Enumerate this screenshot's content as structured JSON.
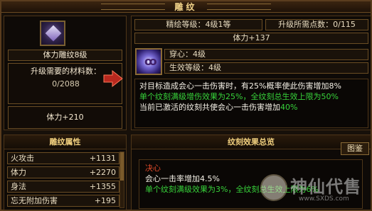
{
  "window": {
    "title": "雕纹"
  },
  "left_panel": {
    "item_name": "体力雕纹8级",
    "req_label": "升级需要的材料数：",
    "req_value": "0/2088",
    "stat": "体力+210"
  },
  "right_panel": {
    "rank": "精绘等级：4级1等",
    "points": "升级所需点数：0/115",
    "hp": "体力+137",
    "sub_name": "穿心：4级",
    "sub_level": "生效等级：4级",
    "desc": {
      "line1": "对目标造成会心一击伤害时，有25%概率使此伤害增加8%",
      "line2": "单个纹刻满级增伤效果为25%，全纹刻总生效上限为50%",
      "line3_prefix": "当前已激活的纹刻共使会心一击伤害增加",
      "line3_value": "40%"
    }
  },
  "attributes": {
    "title": "雕纹属性",
    "rows": [
      {
        "name": "火攻击",
        "value": "+1131"
      },
      {
        "name": "体力",
        "value": "+2270"
      },
      {
        "name": "身法",
        "value": "+1355"
      },
      {
        "name": "忘无附加伤害",
        "value": "+195"
      }
    ]
  },
  "effects": {
    "title": "纹刻效果总览",
    "tab": "图鉴",
    "entry_name": "决心",
    "entry_line1": "会心一击率增加4.5%",
    "entry_line2": "单个纹刻满级效果为3%，全纹刻总生效上限为6%"
  },
  "watermark": {
    "text": "神仙代售",
    "url": "www.SXDS.com"
  },
  "colors": {
    "accent": "#f0cf7e",
    "green": "#37d23a",
    "red": "#e04a2a",
    "border": "#6a4d24"
  }
}
